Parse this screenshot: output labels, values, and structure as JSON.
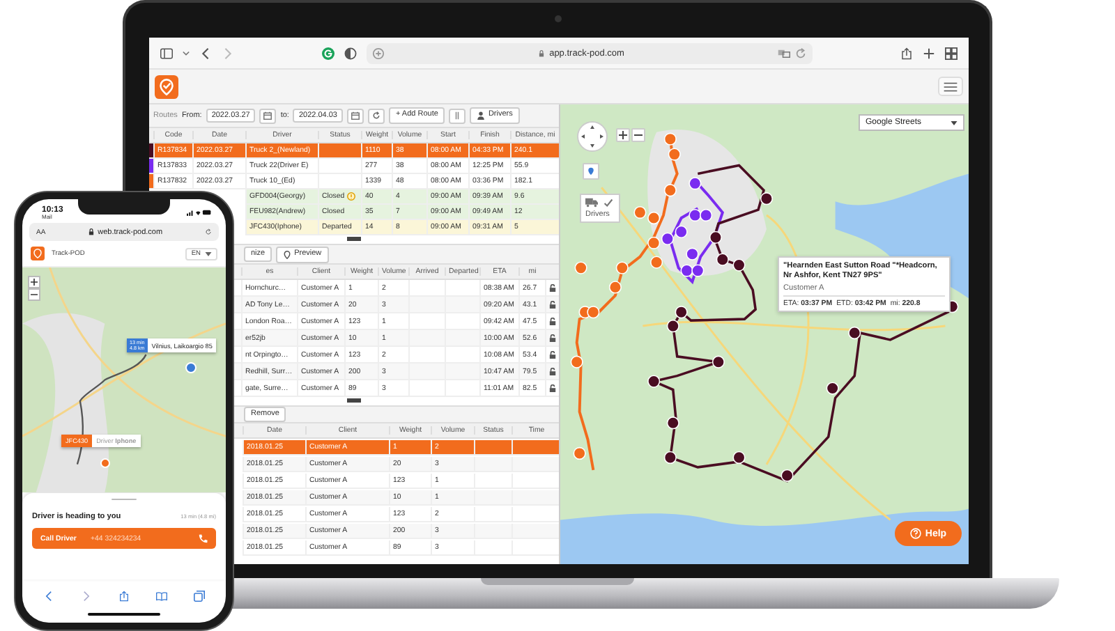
{
  "browser": {
    "url": "app.track-pod.com"
  },
  "routes_toolbar": {
    "title": "Routes",
    "from_label": "From:",
    "from": "2022.03.27",
    "to_label": "to:",
    "to": "2022.04.03",
    "add_button": "+ Add Route",
    "drivers_button": "Drivers"
  },
  "routes_table": {
    "columns": [
      "Code",
      "Date",
      "Driver",
      "Status",
      "Weight",
      "Volume",
      "Start",
      "Finish",
      "Distance, mi"
    ],
    "rows": [
      {
        "kind": "route",
        "selected": true,
        "color": "#4a0d22",
        "code": "R137834",
        "date": "2022.03.27",
        "driver": "Truck 2_(Newland)",
        "weight": "1110",
        "volume": "38",
        "start": "08:00 AM",
        "finish": "04:33 PM",
        "distance": "240.1"
      },
      {
        "kind": "route",
        "selected": false,
        "color": "#7a2cf0",
        "code": "R137833",
        "date": "2022.03.27",
        "driver": "Truck 22(Driver E)",
        "weight": "277",
        "volume": "38",
        "start": "08:00 AM",
        "finish": "12:25 PM",
        "distance": "55.9"
      },
      {
        "kind": "route",
        "selected": false,
        "color": "#f26c1d",
        "code": "R137832",
        "date": "2022.03.27",
        "driver": "Truck 10_(Ed)",
        "weight": "1339",
        "volume": "48",
        "start": "08:00 AM",
        "finish": "03:36 PM",
        "distance": "182.1"
      },
      {
        "kind": "closed",
        "selected": false,
        "alert": true,
        "driver": "GFD004(Georgy)",
        "status": "Closed",
        "weight": "40",
        "volume": "4",
        "start": "09:00 AM",
        "finish": "09:39 AM",
        "distance": "9.6"
      },
      {
        "kind": "closed",
        "selected": false,
        "alert": false,
        "driver": "FEU982(Andrew)",
        "status": "Closed",
        "weight": "35",
        "volume": "7",
        "start": "09:00 AM",
        "finish": "09:49 AM",
        "distance": "12"
      },
      {
        "kind": "departed",
        "selected": false,
        "alert": false,
        "driver": "JFC430(Iphone)",
        "status": "Departed",
        "weight": "14",
        "volume": "8",
        "start": "09:00 AM",
        "finish": "09:31 AM",
        "distance": "5"
      }
    ]
  },
  "stops_toolbar": {
    "optimize_button": "nize",
    "preview_button": "Preview"
  },
  "stops_table": {
    "columns": [
      "es",
      "Client",
      "Weight",
      "Volume",
      "Arrived",
      "Departed",
      "ETA",
      "mi"
    ],
    "rows": [
      {
        "address": "Hornchurc…",
        "client": "Customer A",
        "weight": "1",
        "volume": "2",
        "eta": "08:38 AM",
        "mi": "26.7"
      },
      {
        "address": "AD Tony Le…",
        "client": "Customer A",
        "weight": "20",
        "volume": "3",
        "eta": "09:20 AM",
        "mi": "43.1"
      },
      {
        "address": "London Roa…",
        "client": "Customer A",
        "weight": "123",
        "volume": "1",
        "eta": "09:42 AM",
        "mi": "47.5"
      },
      {
        "address": "er52jb",
        "client": "Customer A",
        "weight": "10",
        "volume": "1",
        "eta": "10:00 AM",
        "mi": "52.6"
      },
      {
        "address": "nt Orpingto…",
        "client": "Customer A",
        "weight": "123",
        "volume": "2",
        "eta": "10:08 AM",
        "mi": "53.4"
      },
      {
        "address": "Redhill, Surr…",
        "client": "Customer A",
        "weight": "200",
        "volume": "3",
        "eta": "10:47 AM",
        "mi": "79.5"
      },
      {
        "address": "gate, Surre…",
        "client": "Customer A",
        "weight": "89",
        "volume": "3",
        "eta": "11:01 AM",
        "mi": "82.5"
      }
    ]
  },
  "orders_toolbar": {
    "remove_button": "Remove"
  },
  "orders_table": {
    "columns": [
      "Date",
      "Client",
      "Weight",
      "Volume",
      "Status",
      "Time"
    ],
    "rows": [
      {
        "selected": true,
        "date": "2018.01.25",
        "client": "Customer A",
        "weight": "1",
        "volume": "2"
      },
      {
        "selected": false,
        "date": "2018.01.25",
        "client": "Customer A",
        "weight": "20",
        "volume": "3"
      },
      {
        "selected": false,
        "date": "2018.01.25",
        "client": "Customer A",
        "weight": "123",
        "volume": "1"
      },
      {
        "selected": false,
        "date": "2018.01.25",
        "client": "Customer A",
        "weight": "10",
        "volume": "1"
      },
      {
        "selected": false,
        "date": "2018.01.25",
        "client": "Customer A",
        "weight": "123",
        "volume": "2"
      },
      {
        "selected": false,
        "date": "2018.01.25",
        "client": "Customer A",
        "weight": "200",
        "volume": "3"
      },
      {
        "selected": false,
        "date": "2018.01.25",
        "client": "Customer A",
        "weight": "89",
        "volume": "3"
      }
    ]
  },
  "map": {
    "layer_select": "Google Streets",
    "drivers_label": "Drivers",
    "popup": {
      "address": "\"Hearnden East Sutton Road \"*Headcorn, Nr Ashfor, Kent TN27 9PS\"",
      "client": "Customer A",
      "times": [
        "ETA: **03:37 PM**",
        "ETD: **03:42 PM**",
        "mi: **220.8**"
      ]
    },
    "help_button": "Help"
  },
  "phone": {
    "time": "10:13",
    "back_app": "Mail",
    "text_size": "AA",
    "url": "web.track-pod.com",
    "brand": "Track-POD",
    "language": "EN",
    "eta_badge": [
      "13 min",
      "4.8 km"
    ],
    "destination": "Vilnius, Laikoargio 85",
    "vehicle": "JFC430",
    "driver_label": "Driver **Iphone**",
    "status": "Driver is heading to you",
    "eta": "13 min (4.8 mi)",
    "call_button": "Call Driver",
    "phone_number": "+44 324234234"
  }
}
